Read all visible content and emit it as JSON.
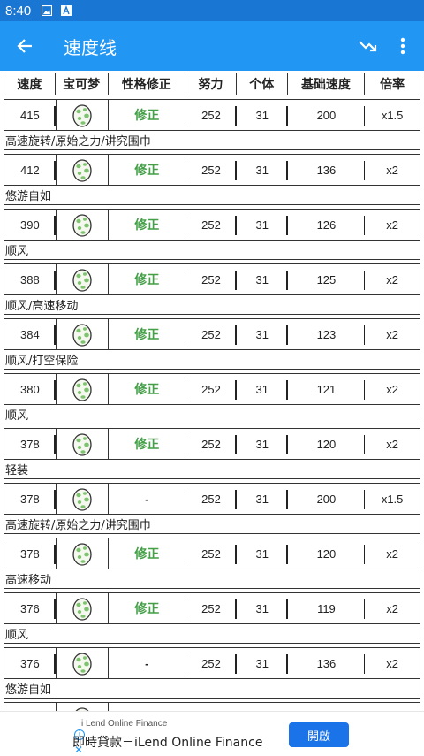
{
  "status_bar": {
    "time": "8:40"
  },
  "app_bar": {
    "title": "速度线"
  },
  "table": {
    "headers": [
      "速度",
      "宝可梦",
      "性格修正",
      "努力",
      "个体",
      "基础速度",
      "倍率"
    ],
    "rows": [
      {
        "speed": "415",
        "nature": "修正",
        "nature_mod": true,
        "ev": "252",
        "iv": "31",
        "base": "200",
        "mult": "x1.5",
        "note": "高速旋转/原始之力/讲究围巾"
      },
      {
        "speed": "412",
        "nature": "修正",
        "nature_mod": true,
        "ev": "252",
        "iv": "31",
        "base": "136",
        "mult": "x2",
        "note": "悠游自如"
      },
      {
        "speed": "390",
        "nature": "修正",
        "nature_mod": true,
        "ev": "252",
        "iv": "31",
        "base": "126",
        "mult": "x2",
        "note": "顺风"
      },
      {
        "speed": "388",
        "nature": "修正",
        "nature_mod": true,
        "ev": "252",
        "iv": "31",
        "base": "125",
        "mult": "x2",
        "note": "顺风/高速移动"
      },
      {
        "speed": "384",
        "nature": "修正",
        "nature_mod": true,
        "ev": "252",
        "iv": "31",
        "base": "123",
        "mult": "x2",
        "note": "顺风/打空保险"
      },
      {
        "speed": "380",
        "nature": "修正",
        "nature_mod": true,
        "ev": "252",
        "iv": "31",
        "base": "121",
        "mult": "x2",
        "note": "顺风"
      },
      {
        "speed": "378",
        "nature": "修正",
        "nature_mod": true,
        "ev": "252",
        "iv": "31",
        "base": "120",
        "mult": "x2",
        "note": "轻装"
      },
      {
        "speed": "378",
        "nature": "-",
        "nature_mod": false,
        "ev": "252",
        "iv": "31",
        "base": "200",
        "mult": "x1.5",
        "note": "高速旋转/原始之力/讲究围巾"
      },
      {
        "speed": "378",
        "nature": "修正",
        "nature_mod": true,
        "ev": "252",
        "iv": "31",
        "base": "120",
        "mult": "x2",
        "note": "高速移动"
      },
      {
        "speed": "376",
        "nature": "修正",
        "nature_mod": true,
        "ev": "252",
        "iv": "31",
        "base": "119",
        "mult": "x2",
        "note": "顺风"
      },
      {
        "speed": "376",
        "nature": "-",
        "nature_mod": false,
        "ev": "252",
        "iv": "31",
        "base": "136",
        "mult": "x2",
        "note": "悠游自如"
      }
    ]
  },
  "ad": {
    "source": "i Lend Online Finance",
    "text": "即時貸款－iLend Online Finance",
    "button": "開啟"
  },
  "colors": {
    "status_bar": "#1976d2",
    "app_bar": "#2196f3",
    "nature_green": "#43a047",
    "ad_button": "#1a73e8"
  },
  "icons": {
    "back": "arrow-left-icon",
    "trend": "trending-down-icon",
    "more": "more-vert-icon",
    "egg": "pokemon-egg-icon"
  }
}
